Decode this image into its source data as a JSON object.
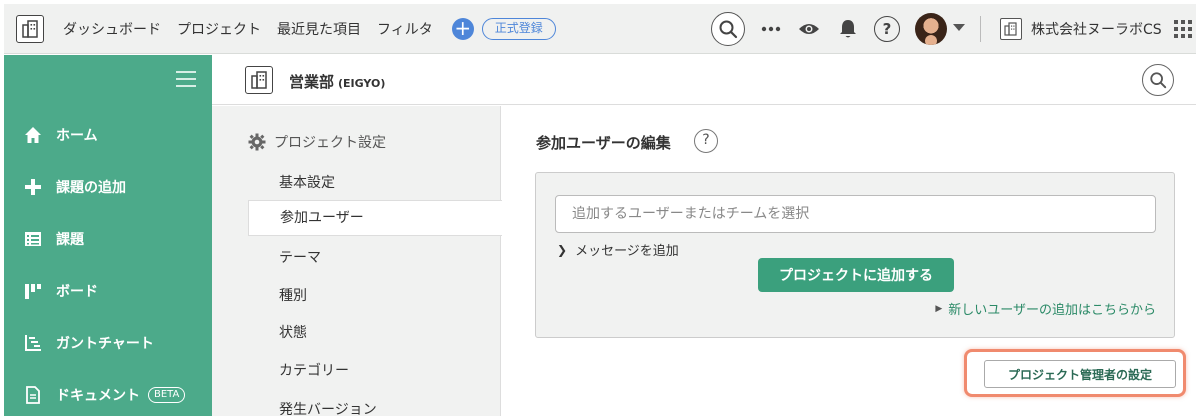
{
  "header": {
    "nav": [
      "ダッシュボード",
      "プロジェクト",
      "最近見た項目",
      "フィルタ"
    ],
    "register_label": "正式登録",
    "company_name": "株式会社ヌーラボCS",
    "icons": [
      "logo-icon",
      "add-icon",
      "search-icon",
      "more-icon",
      "watch-icon",
      "notification-bell-icon",
      "help-icon",
      "avatar",
      "chevron-down-icon",
      "company-icon",
      "app-grid-icon"
    ]
  },
  "sidebar": {
    "items": [
      {
        "label": "ホーム",
        "icon": "home-icon"
      },
      {
        "label": "課題の追加",
        "icon": "plus-icon"
      },
      {
        "label": "課題",
        "icon": "list-icon"
      },
      {
        "label": "ボード",
        "icon": "board-icon"
      },
      {
        "label": "ガントチャート",
        "icon": "gantt-icon"
      },
      {
        "label": "ドキュメント",
        "icon": "document-icon",
        "badge": "BETA"
      }
    ]
  },
  "project": {
    "name": "営業部",
    "key": "(EIGYO)"
  },
  "settings_menu": {
    "heading": "プロジェクト設定",
    "items": [
      "基本設定",
      "参加ユーザー",
      "テーマ",
      "種別",
      "状態",
      "カテゴリー",
      "発生バージョン"
    ],
    "active_index": 1
  },
  "main": {
    "title": "参加ユーザーの編集",
    "help_label": "?",
    "input_placeholder": "追加するユーザーまたはチームを選択",
    "message_toggle": "メッセージを追加",
    "add_button": "プロジェクトに追加する",
    "new_user_link": "新しいユーザーの追加はこちらから",
    "admin_button": "プロジェクト管理者の設定"
  },
  "colors": {
    "sidebar": "#4caa8a",
    "accent_green": "#3ba07d",
    "link_green": "#2b8a67",
    "brand_blue": "#4e86d9",
    "highlight": "#f08a6e"
  }
}
